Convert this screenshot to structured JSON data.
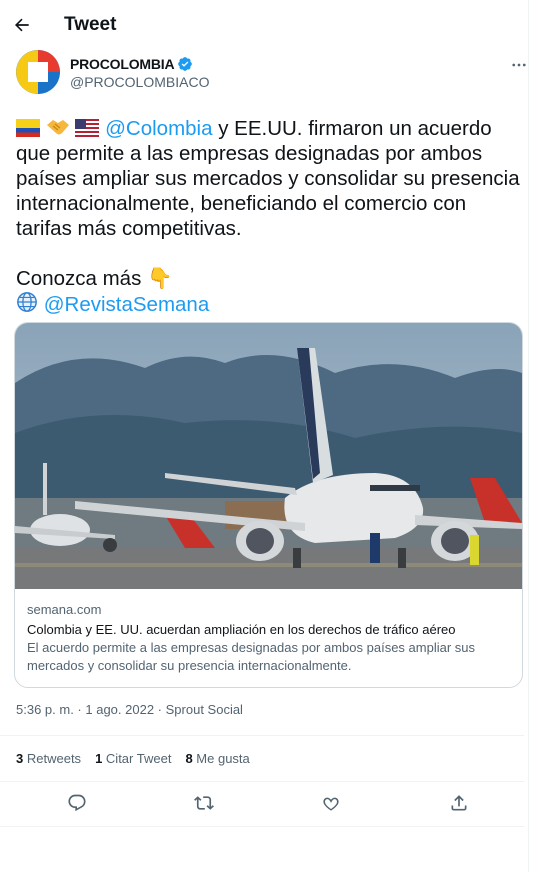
{
  "header": {
    "title": "Tweet"
  },
  "author": {
    "display_name": "PROCOLOMBIA",
    "handle": "@PROCOLOMBIACO"
  },
  "tweet": {
    "mention1": "@Colombia",
    "line1_rest": " y EE.UU. firmaron un acuerdo",
    "line2": "que permite a las empresas designadas por ambos",
    "line3": "países ampliar sus mercados y consolidar su presencia",
    "line4": "internacionalmente, beneficiando el comercio con",
    "line5": "tarifas más competitivas.",
    "cta": "Conozca más",
    "cta_emoji": "👇",
    "globe_emoji": "🌐",
    "mention2": "@RevistaSemana"
  },
  "card": {
    "domain": "semana.com",
    "title": "Colombia y EE. UU. acuerdan ampliación en los derechos de tráfico aéreo",
    "description_line1": "El acuerdo permite a las empresas designadas por ambos países ampliar sus",
    "description_line2": "mercados y consolidar su presencia internacionalmente."
  },
  "meta": {
    "time": "5:36 p. m.",
    "separator": " · ",
    "date": "1 ago. 2022",
    "source": "Sprout Social"
  },
  "stats": {
    "retweets_count": "3",
    "retweets_label": "Retweets",
    "quotes_count": "1",
    "quotes_label": "Citar Tweet",
    "likes_count": "8",
    "likes_label": "Me gusta"
  },
  "icons": {
    "back": "arrow-left-icon",
    "verified": "verified-badge-icon",
    "more": "more-horizontal-icon",
    "reply": "reply-icon",
    "retweet": "retweet-icon",
    "like": "heart-icon",
    "share": "share-icon"
  },
  "colors": {
    "link": "#1d9bf0",
    "text": "#0f1419",
    "secondary": "#536471",
    "border": "#cfd9de"
  }
}
